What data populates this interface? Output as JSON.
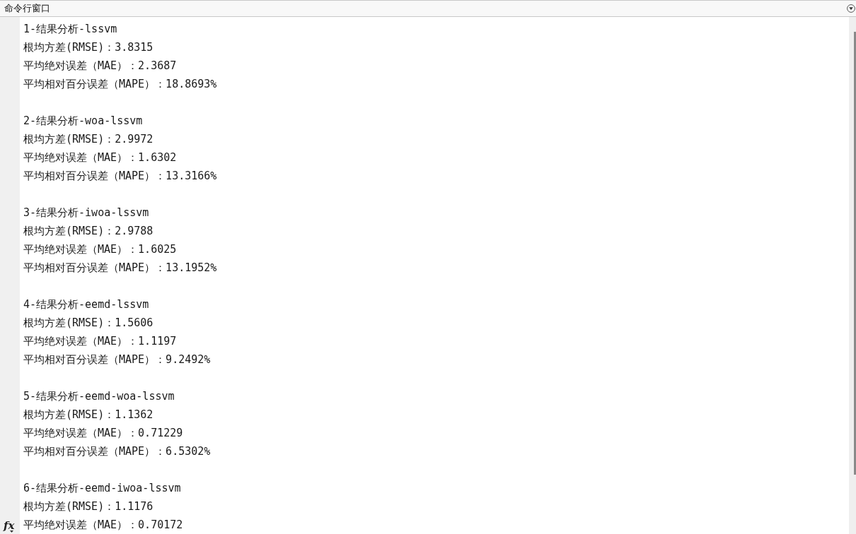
{
  "panel": {
    "title": "命令行窗口"
  },
  "output": [
    {
      "heading": "1-结果分析-lssvm",
      "lines": [
        "根均方差(RMSE)：3.8315",
        "平均绝对误差（MAE）：2.3687",
        "平均相对百分误差（MAPE）：18.8693%"
      ]
    },
    {
      "heading": "2-结果分析-woa-lssvm",
      "lines": [
        "根均方差(RMSE)：2.9972",
        "平均绝对误差（MAE）：1.6302",
        "平均相对百分误差（MAPE）：13.3166%"
      ]
    },
    {
      "heading": "3-结果分析-iwoa-lssvm",
      "lines": [
        "根均方差(RMSE)：2.9788",
        "平均绝对误差（MAE）：1.6025",
        "平均相对百分误差（MAPE）：13.1952%"
      ]
    },
    {
      "heading": "4-结果分析-eemd-lssvm",
      "lines": [
        "根均方差(RMSE)：1.5606",
        "平均绝对误差（MAE）：1.1197",
        "平均相对百分误差（MAPE）：9.2492%"
      ]
    },
    {
      "heading": "5-结果分析-eemd-woa-lssvm",
      "lines": [
        "根均方差(RMSE)：1.1362",
        "平均绝对误差（MAE）：0.71229",
        "平均相对百分误差（MAPE）：6.5302%"
      ]
    },
    {
      "heading": "6-结果分析-eemd-iwoa-lssvm",
      "lines": [
        "根均方差(RMSE)：1.1176",
        "平均绝对误差（MAE）：0.70172"
      ]
    }
  ],
  "function_button": {
    "label": "fx"
  }
}
